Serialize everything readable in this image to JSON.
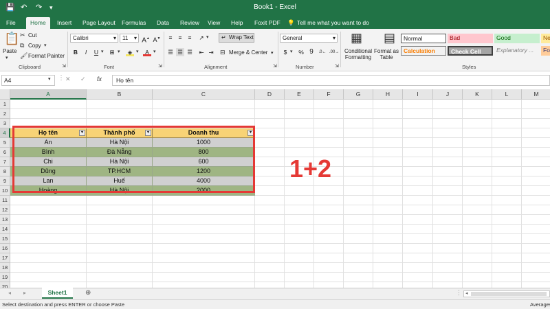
{
  "window": {
    "title": "Book1  -  Excel"
  },
  "tabs": [
    "File",
    "Home",
    "Insert",
    "Page Layout",
    "Formulas",
    "Data",
    "Review",
    "View",
    "Help",
    "Foxit PDF"
  ],
  "tell_me": "Tell me what you want to do",
  "clipboard": {
    "paste": "Paste",
    "cut": "Cut",
    "copy": "Copy",
    "format_painter": "Format Painter",
    "group": "Clipboard"
  },
  "font": {
    "name": "Calibri",
    "size": "11",
    "group": "Font"
  },
  "alignment": {
    "wrap": "Wrap Text",
    "merge": "Merge & Center",
    "group": "Alignment"
  },
  "number": {
    "format": "General",
    "group": "Number"
  },
  "styles": {
    "conditional": "Conditional Formatting",
    "format_as_table": "Format as Table",
    "group": "Styles",
    "cells": [
      "Normal",
      "Bad",
      "Good",
      "Ne",
      "Calculation",
      "Check Cell",
      "Explanatory ...",
      "Fo"
    ]
  },
  "formula_bar": {
    "name_box": "A4",
    "fx": "fx",
    "content": "Họ tên"
  },
  "columns": [
    "A",
    "B",
    "C",
    "D",
    "E",
    "F",
    "G",
    "H",
    "I",
    "J",
    "K",
    "L",
    "M"
  ],
  "rows": [
    "1",
    "2",
    "3",
    "4",
    "5",
    "6",
    "7",
    "8",
    "9",
    "10",
    "11",
    "12",
    "13",
    "14",
    "15",
    "16",
    "17",
    "18",
    "19",
    "20"
  ],
  "table": {
    "headers": [
      "Họ tên",
      "Thành phố",
      "Doanh thu"
    ],
    "rows": [
      [
        "An",
        "Hà Nội",
        "1000"
      ],
      [
        "Bình",
        "Đà Nẵng",
        "800"
      ],
      [
        "Chi",
        "Hà Nội",
        "600"
      ],
      [
        "Dũng",
        "TP.HCM",
        "1200"
      ],
      [
        "Lan",
        "Huế",
        "4000"
      ],
      [
        "Hoàng",
        "Hà Nội",
        "2000"
      ]
    ]
  },
  "annotation": "1+2",
  "sheet": {
    "name": "Sheet1"
  },
  "status": {
    "text": "Select destination and press ENTER or choose Paste",
    "right": "Averages"
  },
  "colors": {
    "excel_green": "#217346",
    "header_fill": "#f8d376",
    "row_a": "#d0d0d0",
    "row_b": "#9fb583",
    "annotation": "#e53935"
  }
}
